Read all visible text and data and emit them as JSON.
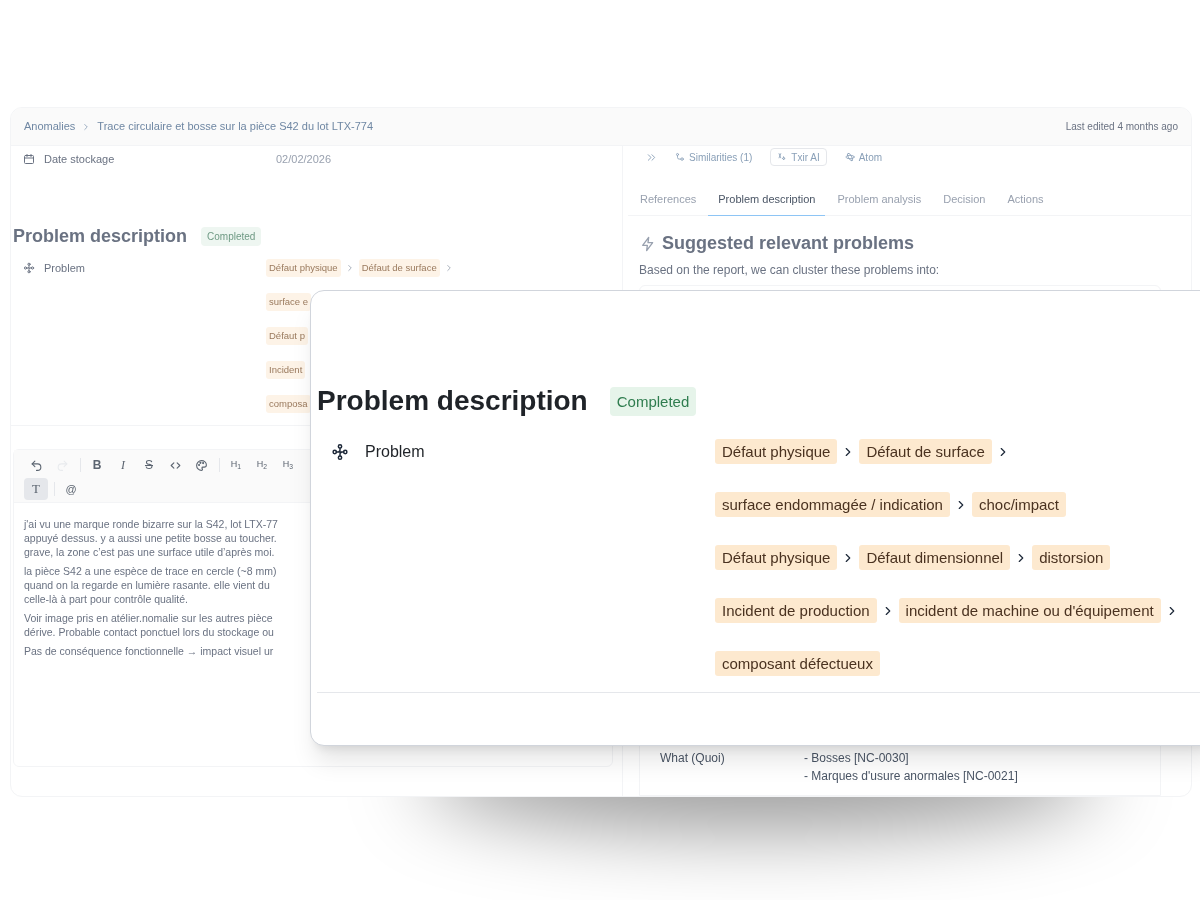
{
  "breadcrumb": [
    "Anomalies",
    "Trace circulaire et bosse sur la pièce S42 du lot LTX-774"
  ],
  "last_edited": "Last edited 4 months ago",
  "left": {
    "fields": [
      {
        "label": "Date stockage",
        "value": "02/02/2026"
      }
    ],
    "section": {
      "title": "Problem description",
      "status": "Completed",
      "problem_label": "Problem",
      "chains": [
        {
          "tags": [
            "Défaut physique",
            "Défaut de surface"
          ],
          "trailing_chevron": true
        },
        {
          "tags": [
            "surface e"
          ],
          "trailing_chevron": false
        },
        {
          "tags": [
            "Défaut p"
          ],
          "trailing_chevron": false
        },
        {
          "tags": [
            "Incident"
          ],
          "trailing_chevron": false
        },
        {
          "tags": [
            "composa"
          ],
          "trailing_chevron": false
        }
      ]
    },
    "editor": {
      "toolbar": [
        {
          "kind": "undo",
          "active": false,
          "disabled": false
        },
        {
          "kind": "redo",
          "active": false,
          "disabled": true
        },
        {
          "kind": "bold",
          "label": "B",
          "active": false,
          "disabled": false
        },
        {
          "kind": "italic",
          "label": "I",
          "active": false,
          "disabled": false
        },
        {
          "kind": "strike",
          "label": "S",
          "active": false,
          "disabled": false
        },
        {
          "kind": "code",
          "active": false,
          "disabled": false
        },
        {
          "kind": "palette",
          "active": false,
          "disabled": false
        },
        {
          "kind": "heading",
          "label": "H$_{1}$",
          "active": false,
          "disabled": false
        },
        {
          "kind": "heading",
          "label": "H$_{2}$",
          "active": false,
          "disabled": false
        },
        {
          "kind": "heading",
          "label": "H$_{3}$",
          "active": false,
          "disabled": false
        },
        {
          "kind": "text",
          "label": "T",
          "active": true,
          "disabled": false
        },
        {
          "kind": "mention",
          "label": "@",
          "active": false,
          "disabled": false
        }
      ],
      "paragraphs": [
        [
          "j'ai vu une marque ronde bizarre sur la S42, lot LTX-77",
          "appuyé dessus. y a aussi une petite bosse au toucher.",
          "grave, la zone c’est pas une surface utile d’après moi."
        ],
        [
          "la pièce S42 a une espèce de trace en cercle (~8 mm)",
          "quand on la regarde en lumière rasante. elle vient du",
          "celle-là à part pour contrôle qualité."
        ],
        [
          "Voir image pris en atélier.nomalie sur les autres pièce",
          "dérive. Probable contact ponctuel lors du stockage ou"
        ],
        [
          "Pas de conséquence fonctionnelle → impact visuel ur"
        ]
      ]
    }
  },
  "right": {
    "toolbar": [
      {
        "kind": "similarities",
        "label": "Similarities (1)"
      },
      {
        "kind": "ai",
        "label": "Txir AI"
      },
      {
        "kind": "atom",
        "label": "Atom"
      }
    ],
    "tabs": [
      {
        "label": "References",
        "selected": false
      },
      {
        "label": "Problem description",
        "selected": true
      },
      {
        "label": "Problem analysis",
        "selected": false
      },
      {
        "label": "Decision",
        "selected": false
      },
      {
        "label": "Actions",
        "selected": false
      }
    ],
    "suggestions": {
      "title": "Suggested relevant problems",
      "subtitle": "Based on the report, we can cluster these problems into:"
    },
    "table_row": {
      "label": "What (Quoi)",
      "values": [
        "- Bosses [NC-0030]",
        "- Marques d'usure anormales [NC-0021]"
      ]
    }
  },
  "card": {
    "title": "Problem description",
    "status": "Completed",
    "problem_label": "Problem",
    "chains": [
      {
        "tags": [
          "Défaut physique",
          "Défaut de surface"
        ],
        "trailing_chevron": true
      },
      {
        "tags": [
          "surface endommagée / indication",
          "choc/impact"
        ],
        "trailing_chevron": false
      },
      {
        "tags": [
          "Défaut physique",
          "Défaut dimensionnel",
          "distorsion"
        ],
        "trailing_chevron": false
      },
      {
        "tags": [
          "Incident de production",
          "incident de machine ou d'équipement"
        ],
        "trailing_chevron": true
      },
      {
        "tags": [
          "composant défectueux"
        ],
        "trailing_chevron": false
      }
    ]
  }
}
